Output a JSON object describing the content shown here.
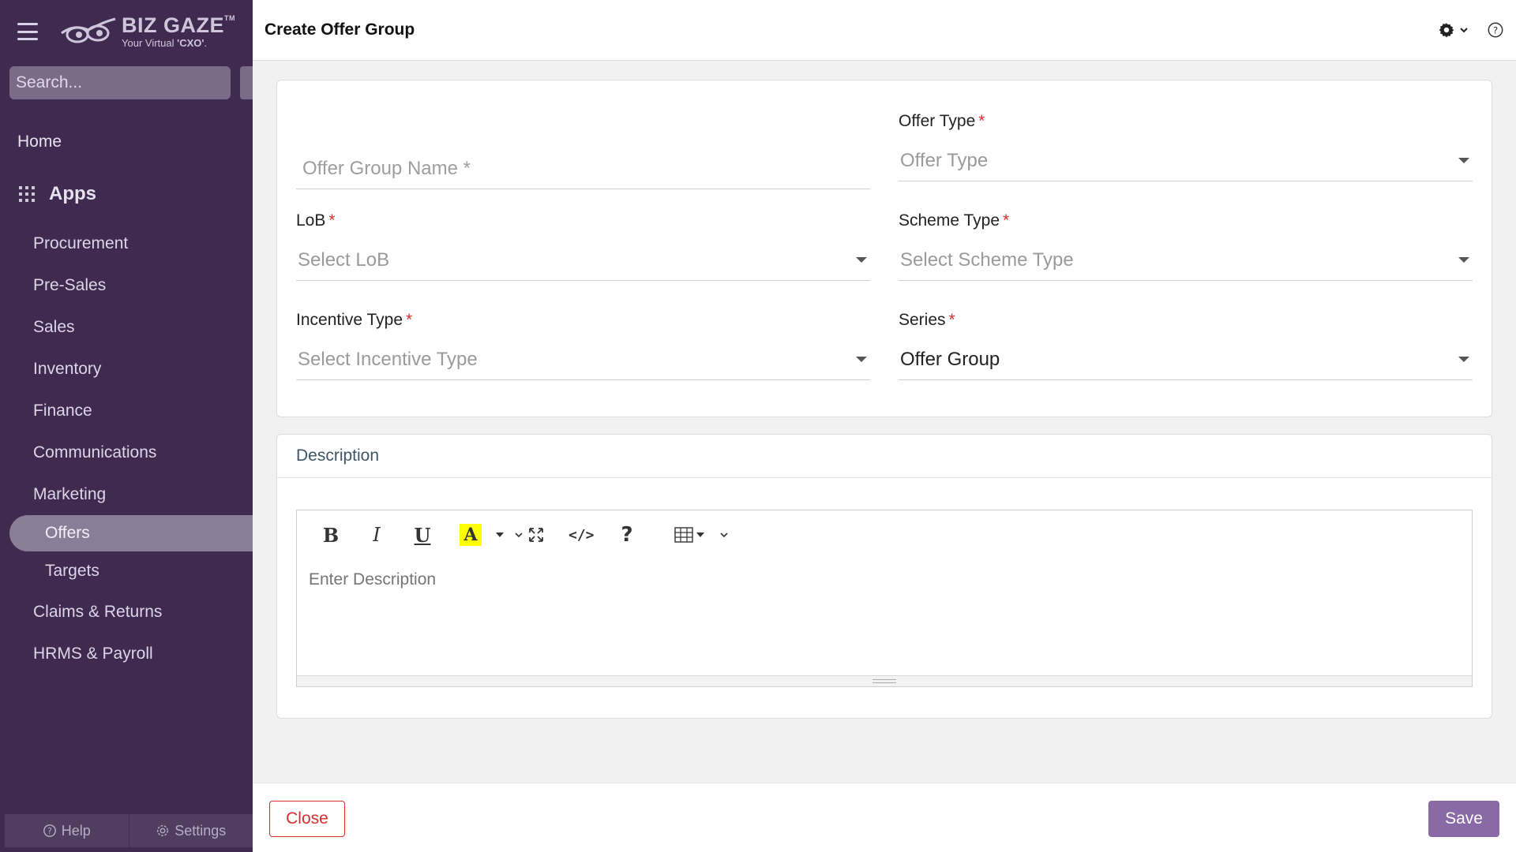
{
  "sidebar": {
    "brand": {
      "name": "BIZ GAZE",
      "tm": "TM",
      "tagline_pre": "Your Virtual ",
      "tagline_bold": "'CXO'",
      "tagline_post": "."
    },
    "search_placeholder": "Search...",
    "home": "Home",
    "apps_label": "Apps",
    "items": [
      "Procurement",
      "Pre-Sales",
      "Sales",
      "Inventory",
      "Finance",
      "Communications",
      "Marketing"
    ],
    "marketing_sub": [
      "Offers",
      "Targets"
    ],
    "items_after": [
      "Claims & Returns",
      "HRMS & Payroll"
    ],
    "bottom": {
      "help": "Help",
      "settings": "Settings"
    }
  },
  "header": {
    "title": "Create Offer Group"
  },
  "form": {
    "offer_group_name": {
      "placeholder": "Offer Group Name *",
      "value": ""
    },
    "offer_type": {
      "label": "Offer Type",
      "placeholder": "Offer Type"
    },
    "lob": {
      "label": "LoB",
      "placeholder": "Select LoB"
    },
    "scheme_type": {
      "label": "Scheme Type",
      "placeholder": "Select Scheme Type"
    },
    "incentive_type": {
      "label": "Incentive Type",
      "placeholder": "Select Incentive Type"
    },
    "series": {
      "label": "Series",
      "value": "Offer Group"
    },
    "required_mark": "*"
  },
  "description": {
    "title": "Description",
    "placeholder": "Enter Description",
    "toolbar": {
      "bold": "B",
      "italic": "I",
      "underline": "U",
      "color": "A",
      "code": "</>",
      "help": "?"
    }
  },
  "footer": {
    "close_label": "Close",
    "save_label": "Save"
  },
  "colors": {
    "sidebar_bg": "#3e2b4f",
    "active_item": "#8a7d96",
    "save_bg": "#8a6aa6",
    "close": "#d32f2f",
    "required": "#d32f2f",
    "highlight": "#ffff00"
  }
}
